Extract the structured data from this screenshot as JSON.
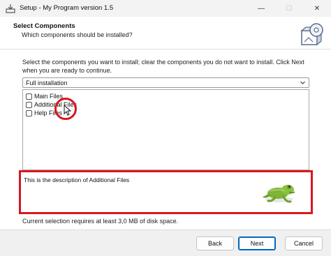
{
  "window": {
    "title": "Setup - My Program version 1.5",
    "minimize_glyph": "—",
    "maximize_glyph": "☐",
    "close_glyph": "✕"
  },
  "header": {
    "title": "Select Components",
    "subtitle": "Which components should be installed?",
    "icon": "install-disc-icon"
  },
  "instructions": "Select the components you want to install; clear the components you do not want to install. Click Next when you are ready to continue.",
  "setup_type": {
    "selected": "Full installation"
  },
  "components": [
    {
      "label": "Main Files",
      "checked": false
    },
    {
      "label": "Additional Files",
      "checked": false
    },
    {
      "label": "Help Files",
      "checked": false
    }
  ],
  "description": "This is the description of Additional Files",
  "disk_space": "Current selection requires at least 3,0 MB of disk space.",
  "buttons": {
    "back": "Back",
    "next": "Next",
    "cancel": "Cancel"
  },
  "colors": {
    "highlight": "#d9161f",
    "accent": "#0067c0"
  }
}
